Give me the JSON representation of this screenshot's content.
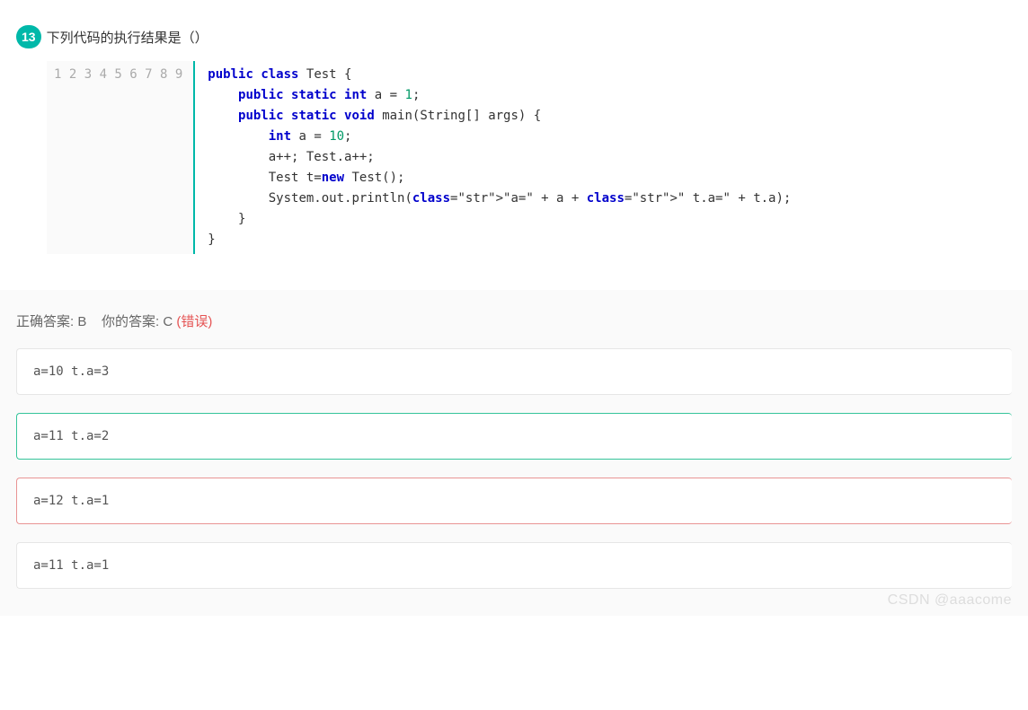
{
  "question": {
    "number": "13",
    "text": "下列代码的执行结果是（）",
    "code_lines": [
      "public class Test {",
      "    public static int a = 1;",
      "    public static void main(String[] args) {",
      "        int a = 10;",
      "        a++; Test.a++;",
      "        Test t=new Test();",
      "        System.out.println(\"a=\" + a + \" t.a=\" + t.a);",
      "    }",
      "}"
    ],
    "line_numbers": [
      "1",
      "2",
      "3",
      "4",
      "5",
      "6",
      "7",
      "8",
      "9"
    ]
  },
  "answer": {
    "correct_label": "正确答案: B",
    "your_label": "你的答案: C",
    "wrong_text": "(错误)"
  },
  "options": [
    {
      "text": "a=10 t.a=3",
      "state": "normal"
    },
    {
      "text": "a=11 t.a=2",
      "state": "correct"
    },
    {
      "text": "a=12 t.a=1",
      "state": "wrong"
    },
    {
      "text": "a=11 t.a=1",
      "state": "normal"
    }
  ],
  "watermark": "CSDN @aaacome"
}
